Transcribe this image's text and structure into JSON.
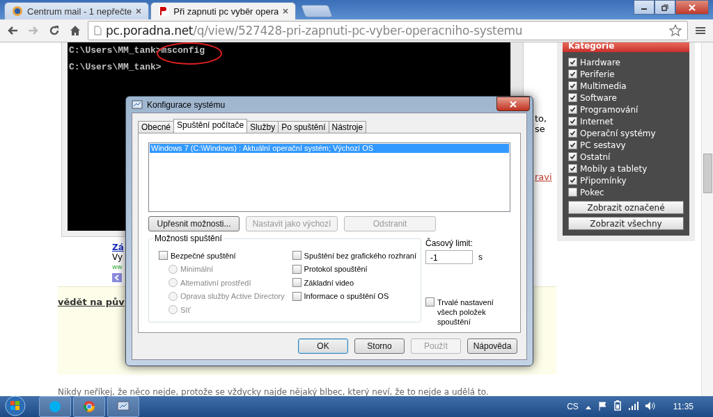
{
  "browser": {
    "tabs": [
      {
        "title": "Centrum mail - 1 nepřečte",
        "selected": false
      },
      {
        "title": "Při zapnuti pc vyběr opera",
        "selected": true
      }
    ],
    "address": {
      "host": "pc.poradna.net",
      "path": "/q/view/527428-pri-zapnuti-pc-vyber-operacniho-systemu"
    }
  },
  "page": {
    "console_lines": [
      "C:\\Users\\MM_tank>msconfig",
      "C:\\Users\\MM_tank>"
    ],
    "right_fragments": [
      "to,",
      "se",
      "ravi"
    ],
    "ad_fragments": [
      "Zá",
      "Vy",
      "ww"
    ],
    "highlight_heading": "vědět na pův",
    "footer_text": "Nikdy neříkej, že něco nejde, protože se vždycky najde nějaký blbec, který neví, že to nejde a udělá to."
  },
  "sidebar": {
    "title": "Kategorie",
    "categories": [
      {
        "label": "Hardware",
        "checked": true
      },
      {
        "label": "Periferie",
        "checked": true
      },
      {
        "label": "Multimedia",
        "checked": true
      },
      {
        "label": "Software",
        "checked": true
      },
      {
        "label": "Programování",
        "checked": true
      },
      {
        "label": "Internet",
        "checked": true
      },
      {
        "label": "Operační systémy",
        "checked": true
      },
      {
        "label": "PC sestavy",
        "checked": true
      },
      {
        "label": "Ostatní",
        "checked": true
      },
      {
        "label": "Mobily a tablety",
        "checked": true
      },
      {
        "label": "Připomínky",
        "checked": true
      },
      {
        "label": "Pokec",
        "checked": false
      }
    ],
    "buttons": [
      "Zobrazit označené",
      "Zobrazit všechny"
    ]
  },
  "dialog": {
    "title": "Konfigurace systému",
    "tabs": [
      {
        "label": "Obecné",
        "selected": false
      },
      {
        "label": "Spuštění počítače",
        "selected": true
      },
      {
        "label": "Služby",
        "selected": false
      },
      {
        "label": "Po spuštění",
        "selected": false
      },
      {
        "label": "Nástroje",
        "selected": false
      }
    ],
    "os_list": [
      {
        "label": "Windows 7 (C:\\Windows) : Aktuální operační systém; Výchozí OS",
        "selected": true
      }
    ],
    "list_buttons": [
      {
        "label": "Upřesnit možnosti...",
        "disabled": false
      },
      {
        "label": "Nastavit jako výchozí",
        "disabled": true
      },
      {
        "label": "Odstranit",
        "disabled": true
      }
    ],
    "boot_options": {
      "title": "Možnosti spuštění",
      "safe_boot": {
        "label": "Bezpečné spuštění",
        "checked": false
      },
      "safe_modes": [
        {
          "label": "Minimální",
          "selected": false,
          "disabled": true
        },
        {
          "label": "Alternativní prostředí",
          "selected": false,
          "disabled": true
        },
        {
          "label": "Oprava služby Active Directory",
          "selected": false,
          "disabled": true
        },
        {
          "label": "Síť",
          "selected": false,
          "disabled": true
        }
      ],
      "flags": [
        {
          "label": "Spuštění bez grafického rozhraní",
          "checked": false
        },
        {
          "label": "Protokol spouštění",
          "checked": false
        },
        {
          "label": "Základní video",
          "checked": false
        },
        {
          "label": "Informace o spuštění OS",
          "checked": false
        }
      ]
    },
    "timeout": {
      "label": "Časový limit:",
      "value": "-1",
      "unit": "s"
    },
    "permanent": {
      "label": "Trvalé nastavení všech položek spouštění",
      "checked": false
    },
    "buttons": [
      {
        "label": "OK",
        "disabled": false,
        "default": true
      },
      {
        "label": "Storno",
        "disabled": false,
        "default": false
      },
      {
        "label": "Použít",
        "disabled": true,
        "default": false
      },
      {
        "label": "Nápověda",
        "disabled": false,
        "default": false
      }
    ]
  },
  "taskbar": {
    "language": "CS",
    "time": "11:35"
  }
}
